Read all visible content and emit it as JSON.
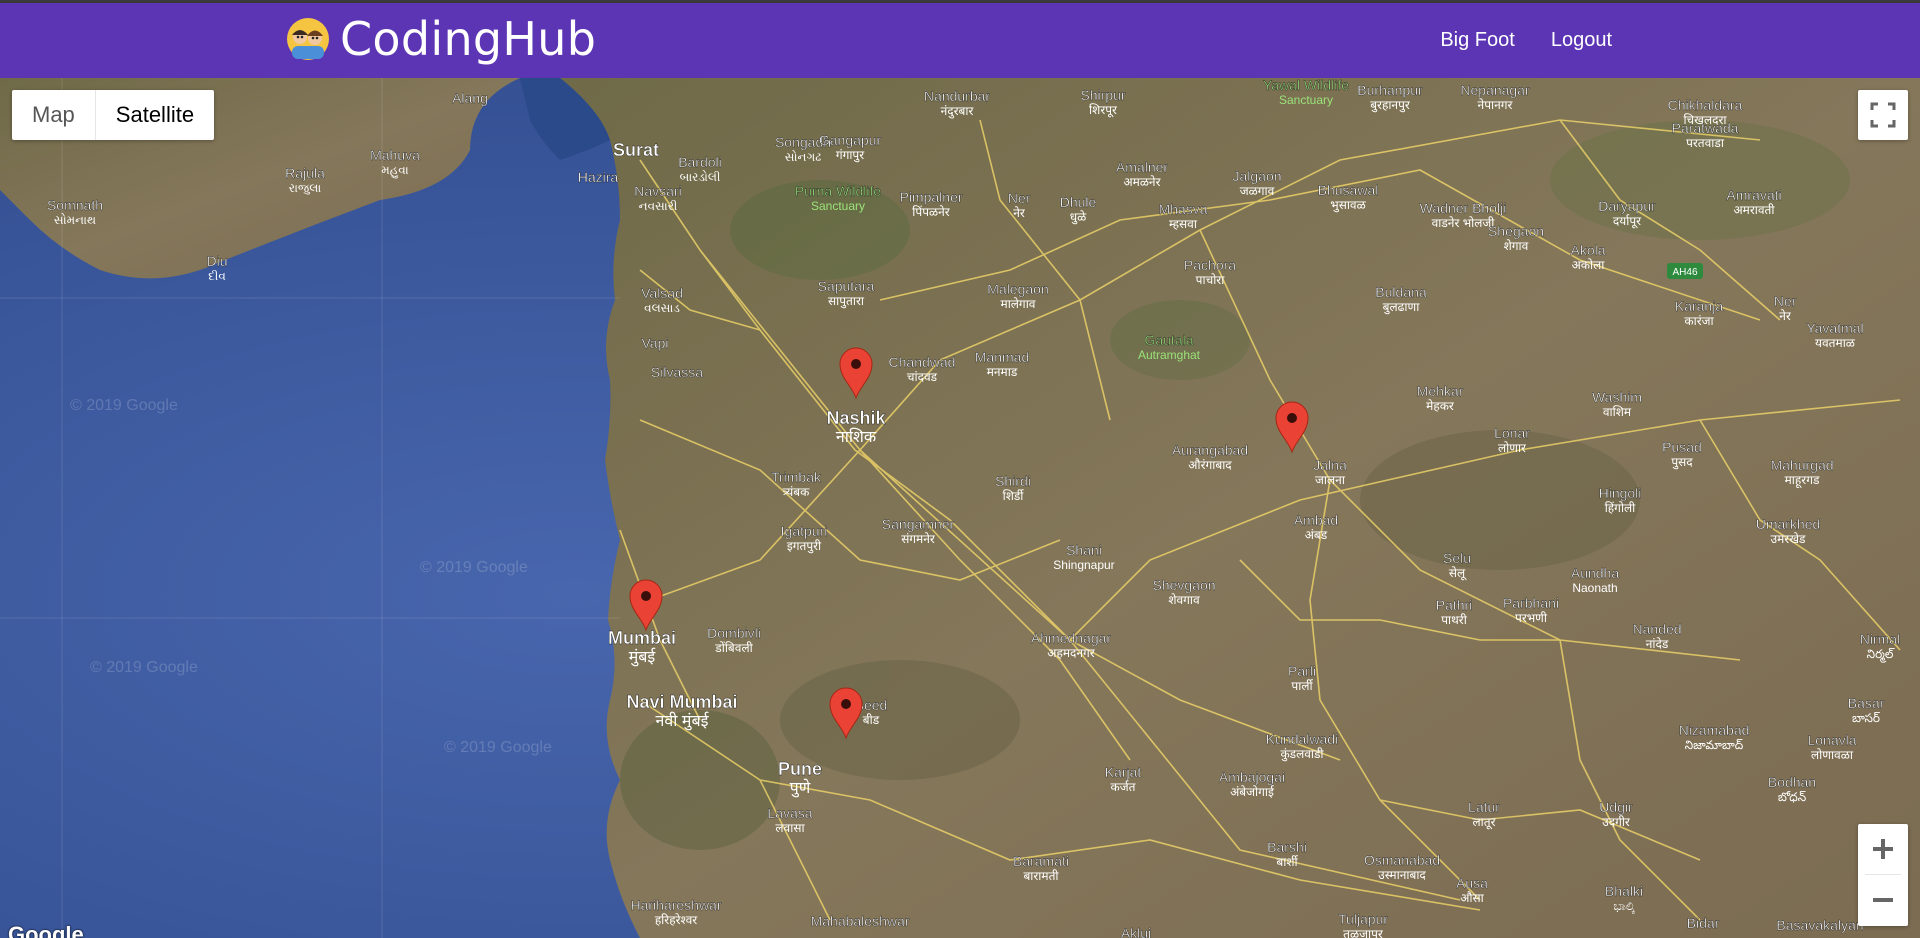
{
  "brand": {
    "name": "CodingHub"
  },
  "nav": {
    "links": [
      "Big Foot",
      "Logout"
    ]
  },
  "map_controls": {
    "map_label": "Map",
    "satellite_label": "Satellite",
    "selected": "Satellite"
  },
  "attribution": "Google",
  "watermark": "© 2019 Google",
  "markers": [
    "Nashik",
    "Jalna",
    "Mumbai",
    "Pune"
  ],
  "places": [
    {
      "n": "Alang"
    },
    {
      "n": "Mahuva",
      "l": "મહુવા"
    },
    {
      "n": "Rajula",
      "l": "રાજુલા"
    },
    {
      "n": "Somnath",
      "l": "સોમનાથ"
    },
    {
      "n": "Diu",
      "l": "દીવ"
    },
    {
      "n": "Surat"
    },
    {
      "n": "Bardoli",
      "l": "બારડોલી"
    },
    {
      "n": "Hazira"
    },
    {
      "n": "Navsari",
      "l": "નવસારી"
    },
    {
      "n": "Valsad",
      "l": "વલસાડ"
    },
    {
      "n": "Vapi"
    },
    {
      "n": "Silvassa"
    },
    {
      "n": "Songadh",
      "l": "સોનગઢ"
    },
    {
      "n": "Gangapur",
      "l": "गंगापुर"
    },
    {
      "n": "Nandurbar",
      "l": "नंदुरबार"
    },
    {
      "n": "Shirpur",
      "l": "शिरपूर"
    },
    {
      "n": "Yawal Wildlife",
      "l": "Sanctuary"
    },
    {
      "n": "Burhanpur",
      "l": "बुरहानपुर"
    },
    {
      "n": "Nepanagar",
      "l": "नेपानगर"
    },
    {
      "n": "Chikhaldara",
      "l": "चिखलदरा"
    },
    {
      "n": "Paratwada",
      "l": "परतवाडा"
    },
    {
      "n": "Purna Wildlife",
      "l": "Sanctuary"
    },
    {
      "n": "Pimpalner",
      "l": "पिंपळनेर"
    },
    {
      "n": "Ner",
      "l": "नेर"
    },
    {
      "n": "Dhule",
      "l": "धुळे"
    },
    {
      "n": "Amalner",
      "l": "अमळनेर"
    },
    {
      "n": "Jalgaon",
      "l": "जळगाव"
    },
    {
      "n": "Bhusawal",
      "l": "भुसावळ"
    },
    {
      "n": "Mhasva",
      "l": "म्हसवा"
    },
    {
      "n": "Wadner Bholji",
      "l": "वाडनेर भोलजी"
    },
    {
      "n": "Daryapur",
      "l": "दर्यापूर"
    },
    {
      "n": "Amravati",
      "l": "अमरावती"
    },
    {
      "n": "Saputara",
      "l": "सापुतारा"
    },
    {
      "n": "Malegaon",
      "l": "मालेगाव"
    },
    {
      "n": "Pachora",
      "l": "पाचोरा"
    },
    {
      "n": "Shegaon",
      "l": "शेगाव"
    },
    {
      "n": "Akola",
      "l": "अकोला"
    },
    {
      "n": "Buldana",
      "l": "बुलढाणा"
    },
    {
      "n": "Karanja",
      "l": "कारंजा"
    },
    {
      "n": "Ner",
      "l": "नेर"
    },
    {
      "n": "Yavatmal",
      "l": "यवतमाळ"
    },
    {
      "n": "Chandwad",
      "l": "चांदवड"
    },
    {
      "n": "Manmad",
      "l": "मनमाड"
    },
    {
      "n": "Gautala",
      "l": "Autramghat"
    },
    {
      "n": "Mehkar",
      "l": "मेहकर"
    },
    {
      "n": "Washim",
      "l": "वाशिम"
    },
    {
      "n": "Nashik",
      "l": "नाशिक"
    },
    {
      "n": "Lonar",
      "l": "लोणार"
    },
    {
      "n": "Pusad",
      "l": "पुसद"
    },
    {
      "n": "Mahurgad",
      "l": "माहूरगड"
    },
    {
      "n": "Aurangabad",
      "l": "औरंगाबाद"
    },
    {
      "n": "Jalna",
      "l": "जालना"
    },
    {
      "n": "Trimbak",
      "l": "त्र्यंबक"
    },
    {
      "n": "Shirdi",
      "l": "शिर्डी"
    },
    {
      "n": "Ambad",
      "l": "अंबड"
    },
    {
      "n": "Hingoli",
      "l": "हिंगोली"
    },
    {
      "n": "Umarkhed",
      "l": "उमरखेड"
    },
    {
      "n": "Sangamner",
      "l": "संगमनेर"
    },
    {
      "n": "Igatpuri",
      "l": "इगतपुरी"
    },
    {
      "n": "Shani",
      "l": "Shingnapur"
    },
    {
      "n": "Selu",
      "l": "सेलू"
    },
    {
      "n": "Aundha",
      "l": "Naonath"
    },
    {
      "n": "Shevgaon",
      "l": "शेवगाव"
    },
    {
      "n": "Pathri",
      "l": "पाथरी"
    },
    {
      "n": "Parbhani",
      "l": "परभणी"
    },
    {
      "n": "Mumbai",
      "l": "मुंबई"
    },
    {
      "n": "Dombivli",
      "l": "डोंबिवली"
    },
    {
      "n": "Ahmednagar",
      "l": "अहमदनगर"
    },
    {
      "n": "Nanded",
      "l": "नांदेड"
    },
    {
      "n": "Nirmal",
      "l": "నిర్మల్"
    },
    {
      "n": "Navi Mumbai",
      "l": "नवी मुंबई"
    },
    {
      "n": "Beed",
      "l": "बीड"
    },
    {
      "n": "Parli",
      "l": "पार्ली"
    },
    {
      "n": "Basar",
      "l": "బాసర్"
    },
    {
      "n": "Kundalwadi",
      "l": "कुंडलवाडी"
    },
    {
      "n": "Nizamabad",
      "l": "నిజామాబాద్"
    },
    {
      "n": "Lonavla",
      "l": "लोणावळा"
    },
    {
      "n": "Pune",
      "l": "पुणे"
    },
    {
      "n": "Karjat",
      "l": "कर्जत"
    },
    {
      "n": "Ambajogai",
      "l": "अंबेजोगाई"
    },
    {
      "n": "Bodhan",
      "l": "బోధన్"
    },
    {
      "n": "Lavasa",
      "l": "लवासा"
    },
    {
      "n": "Latur",
      "l": "लातूर"
    },
    {
      "n": "Udgir",
      "l": "उदगीर"
    },
    {
      "n": "Baramati",
      "l": "बारामती"
    },
    {
      "n": "Barshi",
      "l": "बार्शी"
    },
    {
      "n": "Osmanabad",
      "l": "उस्मानाबाद"
    },
    {
      "n": "Ausa",
      "l": "औसा"
    },
    {
      "n": "Bhalki",
      "l": "ಭಾಲ್ಕಿ"
    },
    {
      "n": "Harihareshwar",
      "l": "हरिहरेश्वर"
    },
    {
      "n": "Mahabaleshwar"
    },
    {
      "n": "Tuljapur",
      "l": "तुळजापूर"
    },
    {
      "n": "Bidar"
    },
    {
      "n": "Basavakalyan"
    },
    {
      "n": "Akluj"
    }
  ],
  "road_badge": "AH46",
  "colors": {
    "navbar": "#5c35b5",
    "marker": "#ea4335",
    "sea": "#3b5aa0",
    "land": "#7a6e4e"
  }
}
